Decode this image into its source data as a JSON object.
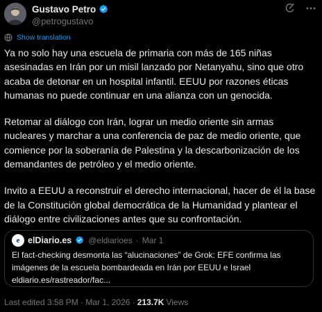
{
  "author": {
    "display_name": "Gustavo Petro",
    "handle": "@petrogustavo",
    "avatar_icon": "profile-photo"
  },
  "colors": {
    "background": "#000000",
    "text": "#e7e9ea",
    "muted": "#71767b",
    "link": "#1d9bf0",
    "verified": "#1d9bf0",
    "border": "#2f3336"
  },
  "translation": {
    "label": "Show translation"
  },
  "body": {
    "paragraphs": [
      "Ya no solo hay una escuela de primaria con más de 165 niñas asesinadas en Irán por un misil lanzado por Netanyahu, sino que otro acaba de detonar en un hospital infantil. EEUU por razones éticas humanas no puede continuar en una alianza con un genocida.",
      "Retomar al diálogo con Irán, lograr un medio oriente sin armas nucleares y marchar a una conferencia de paz de medio oriente, que comience por la soberanía de Palestina y la descarbonización de los demandantes de petróleo y el medio oriente.",
      "Invito a EEUU a reconstruir el derecho internacional, hacer de él la base de la Constitución global democrática de la Humanidad y plantear el diálogo entre civilizaciones antes que su confrontación."
    ]
  },
  "quote": {
    "avatar_letter": "e",
    "name": "elDiario.es",
    "handle": "@eldiarioes",
    "separator": "·",
    "date": "Mar 1",
    "text": "El fact-checking desmonta las “alucinaciones” de Grok: EFE confirma las imágenes de la escuela bombardeada en Irán por EEUU e Israel eldiario.es/rastreador/fac..."
  },
  "footer": {
    "edited": "Last edited 3:58 PM · Mar 1, 2026 ·",
    "views_count": "213.7K",
    "views_label": "Views"
  }
}
